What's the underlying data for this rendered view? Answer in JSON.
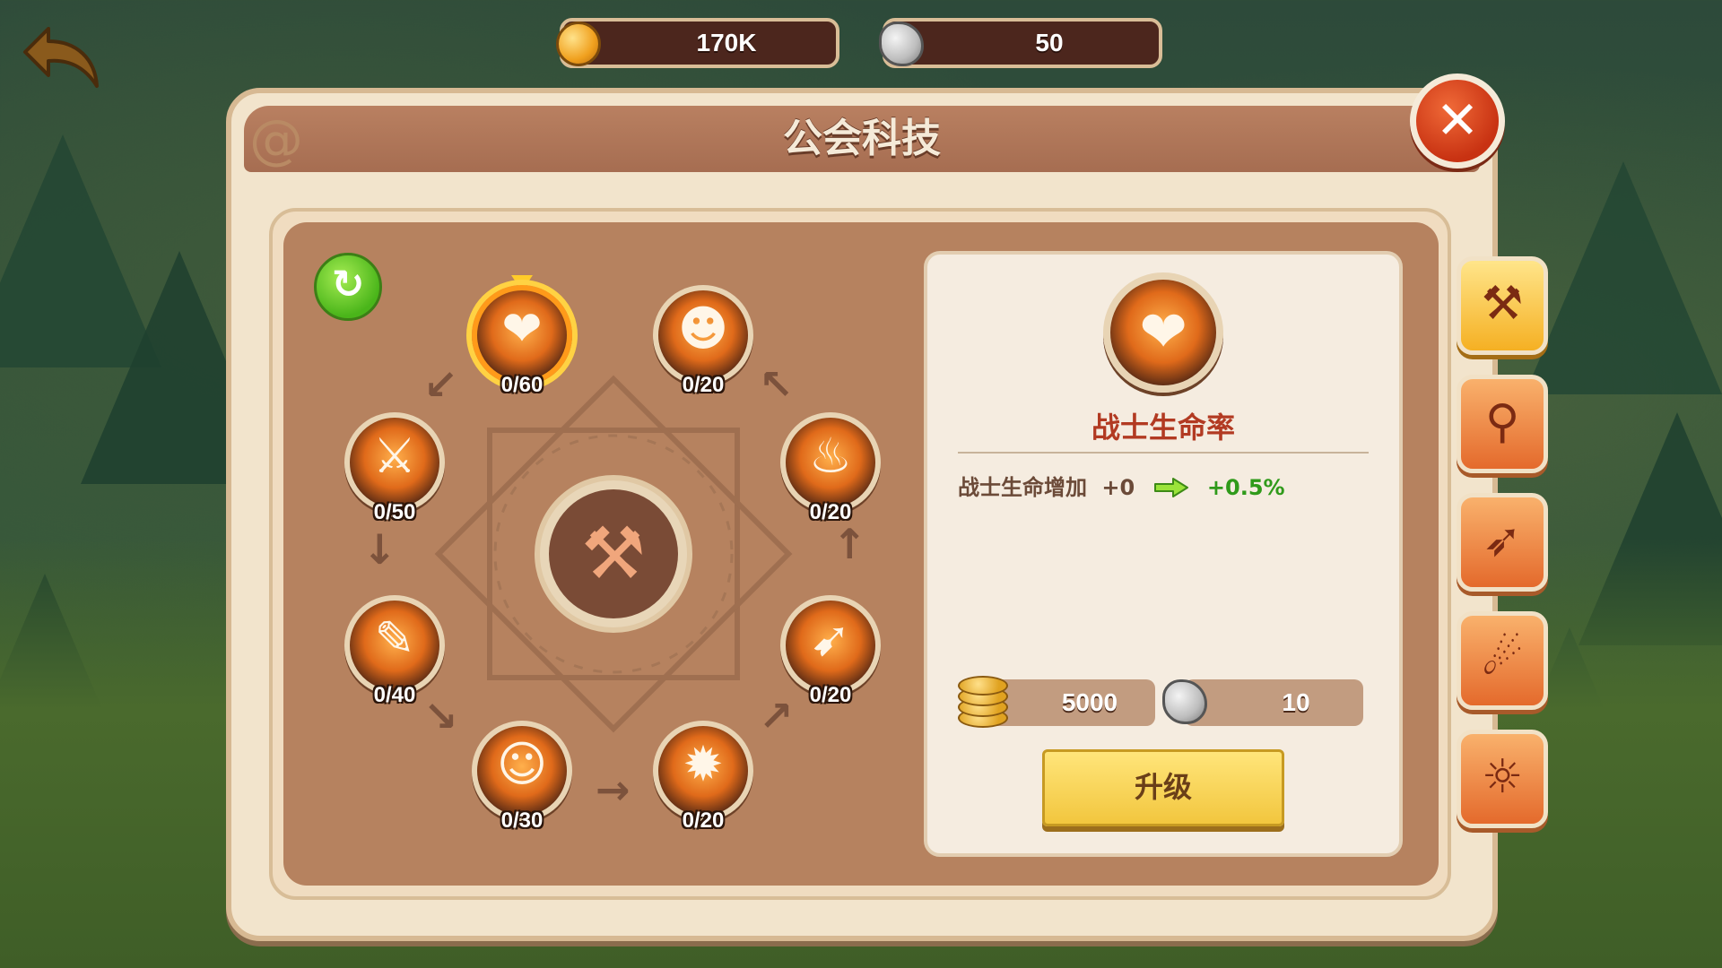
{
  "top_bar": {
    "gold": "170K",
    "stone": "50"
  },
  "panel": {
    "title": "公会科技"
  },
  "tech_nodes": [
    {
      "count": "0/60",
      "icon": "heart-plus-icon",
      "selected": true
    },
    {
      "count": "0/20",
      "icon": "warrior-icon",
      "selected": false
    },
    {
      "count": "0/20",
      "icon": "flame-warrior-icon",
      "selected": false
    },
    {
      "count": "0/20",
      "icon": "dash-warrior-icon",
      "selected": false
    },
    {
      "count": "0/20",
      "icon": "light-burst-icon",
      "selected": false
    },
    {
      "count": "0/30",
      "icon": "gingerbread-icon",
      "selected": false
    },
    {
      "count": "0/40",
      "icon": "slash-icon",
      "selected": false
    },
    {
      "count": "0/50",
      "icon": "sword-icon",
      "selected": false
    }
  ],
  "detail": {
    "name": "战士生命率",
    "effect_label": "战士生命增加",
    "effect_current": "+0",
    "effect_next": "+0.5%",
    "cost_gold": "5000",
    "cost_stone": "10",
    "upgrade_label": "升级"
  },
  "side_tabs": [
    {
      "icon": "hammer-icon",
      "active": true
    },
    {
      "icon": "staff-icon",
      "active": false
    },
    {
      "icon": "bow-icon",
      "active": false
    },
    {
      "icon": "claw-icon",
      "active": false
    },
    {
      "icon": "angel-wings-icon",
      "active": false
    }
  ]
}
